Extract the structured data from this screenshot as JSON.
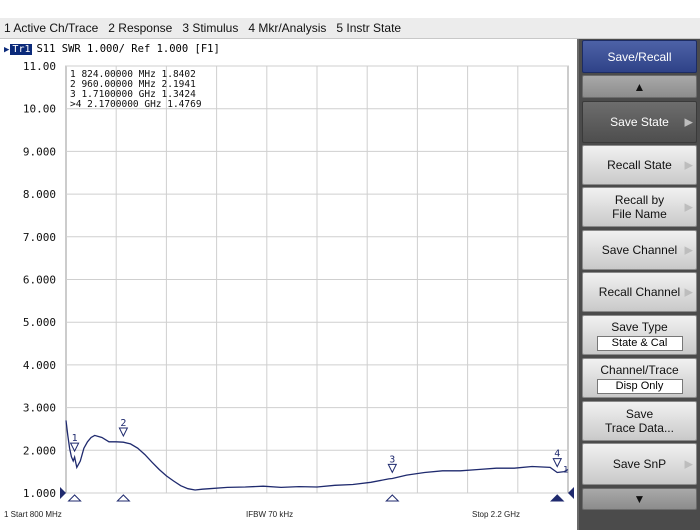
{
  "menu": [
    "1 Active Ch/Trace",
    "2 Response",
    "3 Stimulus",
    "4 Mkr/Analysis",
    "5 Instr State"
  ],
  "trace_header": {
    "badge": "Tr1",
    "text": "S11  SWR 1.000/ Ref 1.000 [F1]"
  },
  "markers_readout": [
    "  1   824.00000 MHz   1.8402",
    "  2   960.00000 MHz   2.1941",
    "  3   1.7100000 GHz   1.3424",
    " >4   2.1700000 GHz   1.4769"
  ],
  "chart_data": {
    "type": "line",
    "ylabel": "",
    "ylim": [
      1.0,
      11.0
    ],
    "yticks": [
      "11.00",
      "10.00",
      "9.000",
      "8.000",
      "7.000",
      "6.000",
      "5.000",
      "4.000",
      "3.000",
      "2.000",
      "1.000"
    ],
    "xlim": [
      0.8,
      2.2
    ],
    "x_unit": "GHz",
    "trace_color": "#1f2a6e",
    "grid": true,
    "series": [
      {
        "x": [
          0.8,
          0.805,
          0.81,
          0.815,
          0.82,
          0.824,
          0.83,
          0.84,
          0.85,
          0.86,
          0.87,
          0.88,
          0.9,
          0.92,
          0.94,
          0.96,
          0.98,
          1.0,
          1.02,
          1.04,
          1.06,
          1.08,
          1.1,
          1.12,
          1.14,
          1.16,
          1.18,
          1.2,
          1.25,
          1.3,
          1.35,
          1.4,
          1.45,
          1.5,
          1.55,
          1.6,
          1.65,
          1.7,
          1.71,
          1.75,
          1.8,
          1.85,
          1.9,
          1.95,
          2.0,
          2.05,
          2.1,
          2.15,
          2.17,
          2.19,
          2.2
        ],
        "y": [
          2.7,
          2.35,
          2.05,
          1.85,
          1.75,
          1.84,
          1.6,
          1.75,
          2.05,
          2.2,
          2.3,
          2.35,
          2.3,
          2.2,
          2.2,
          2.19,
          2.15,
          2.05,
          1.9,
          1.72,
          1.55,
          1.4,
          1.28,
          1.17,
          1.1,
          1.07,
          1.09,
          1.1,
          1.13,
          1.14,
          1.16,
          1.13,
          1.15,
          1.14,
          1.18,
          1.2,
          1.25,
          1.33,
          1.34,
          1.42,
          1.48,
          1.52,
          1.52,
          1.55,
          1.58,
          1.58,
          1.62,
          1.6,
          1.48,
          1.5,
          1.55
        ]
      }
    ],
    "markers": [
      {
        "id": "1",
        "x": 0.824,
        "y": 1.8402
      },
      {
        "id": "2",
        "x": 0.96,
        "y": 2.1941
      },
      {
        "id": "3",
        "x": 1.71,
        "y": 1.3424
      },
      {
        "id": "4",
        "x": 2.17,
        "y": 1.4769
      }
    ]
  },
  "softkeys": {
    "title": "Save/Recall",
    "save_state": "Save State",
    "recall_state": "Recall State",
    "recall_by_line1": "Recall by",
    "recall_by_line2": "File Name",
    "save_channel": "Save Channel",
    "recall_channel": "Recall Channel",
    "save_type_label": "Save Type",
    "save_type_value": "State & Cal",
    "chtrace_label": "Channel/Trace",
    "chtrace_value": "Disp Only",
    "save_trace_line1": "Save",
    "save_trace_line2": "Trace Data...",
    "save_snp": "Save SnP"
  },
  "footer": {
    "start": "1  Start 800 MHz",
    "ifbw": "IFBW 70 kHz",
    "stop": "Stop 2.2 GHz"
  }
}
